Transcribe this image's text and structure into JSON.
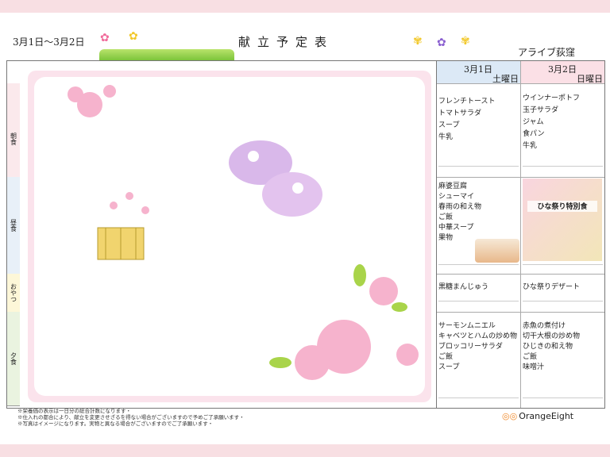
{
  "header": {
    "date_range": "3月1日～3月2日",
    "title": "献立予定表",
    "facility": "アライブ荻窪"
  },
  "row_labels": [
    "朝食",
    "昼食",
    "おやつ",
    "夕食"
  ],
  "days": [
    {
      "date": "3月1日",
      "weekday": "土曜日",
      "breakfast": [
        "フレンチトースト",
        "トマトサラダ",
        "スープ",
        "牛乳"
      ],
      "lunch": [
        "麻婆豆腐",
        "シューマイ",
        "春雨の和え物",
        "ご飯",
        "中華スープ",
        "果物"
      ],
      "snack": [
        "黒糖まんじゅう"
      ],
      "dinner": [
        "サーモンムニエル",
        "キャベツとハムの炒め物",
        "ブロッコリーサラダ",
        "ご飯",
        "スープ"
      ]
    },
    {
      "date": "3月2日",
      "weekday": "日曜日",
      "breakfast": [
        "ウインナーポトフ",
        "玉子サラダ",
        "ジャム",
        "食パン",
        "牛乳"
      ],
      "lunch_special": "ひな祭り特別食",
      "snack": [
        "ひな祭りデザート"
      ],
      "dinner": [
        "赤魚の煮付け",
        "切干大根の炒め物",
        "ひじきの和え物",
        "ご飯",
        "味噌汁"
      ]
    }
  ],
  "notes": [
    "※栄養価の表示は一日分の総合計数になります・",
    "※仕入れの都合により、献立を変更させざるを得ない場合がございますので予めご了承願います・",
    "※写真はイメージになります。実物と異なる場合がございますのでご了承願います・"
  ],
  "logo": {
    "text": "OrangeEight",
    "accent": "#f08a2b"
  },
  "colors": {
    "band": "#f8dfe3",
    "art_frame": "#fbe3ec"
  }
}
